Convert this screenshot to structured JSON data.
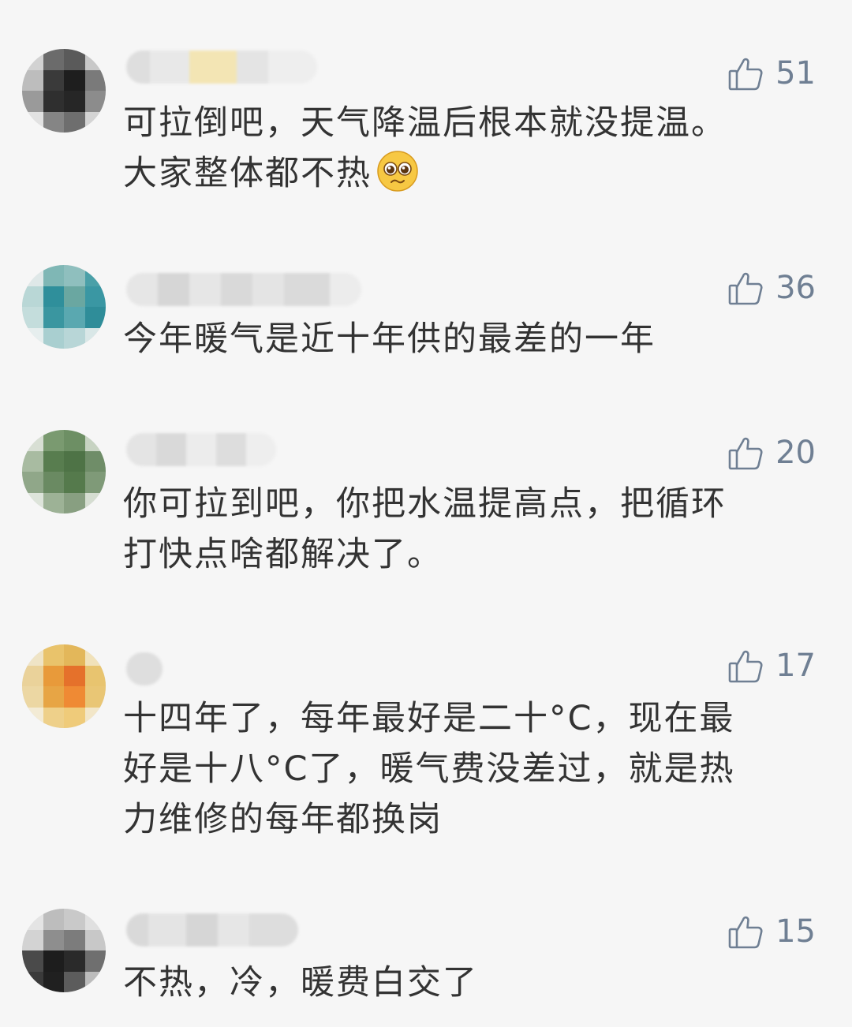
{
  "comments": [
    {
      "likes": "51",
      "lines": [
        "可拉倒吧，天气降温后根本就没提温。",
        "大家整体都不热"
      ],
      "emoji": "pleading-face-icon"
    },
    {
      "likes": "36",
      "lines": [
        "今年暖气是近十年供的最差的一年"
      ]
    },
    {
      "likes": "20",
      "lines": [
        "你可拉到吧，你把水温提高点，把循环",
        "打快点啥都解决了。"
      ]
    },
    {
      "likes": "17",
      "lines": [
        "十四年了，每年最好是二十°C，现在最",
        "好是十八°C了，暖气费没差过，就是热",
        "力维修的每年都换岗"
      ]
    },
    {
      "likes": "15",
      "lines": [
        "不热，冷，暖费白交了"
      ]
    }
  ],
  "colors": {
    "background": "#f6f6f6",
    "text": "#333333",
    "like": "#6f7f93"
  },
  "icons": {
    "like": "thumbs-up-icon"
  }
}
